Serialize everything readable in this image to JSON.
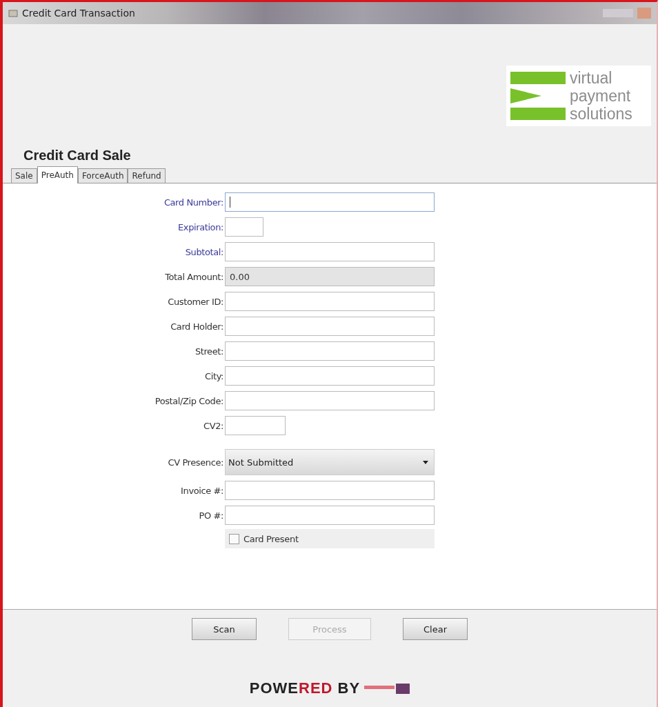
{
  "window": {
    "title": "Credit Card Transaction"
  },
  "logo": {
    "lines": [
      "virtual",
      "payment",
      "solutions"
    ]
  },
  "heading": "Credit Card Sale",
  "tabs": [
    {
      "label": "Sale",
      "selected": false
    },
    {
      "label": "PreAuth",
      "selected": true
    },
    {
      "label": "ForceAuth",
      "selected": false
    },
    {
      "label": "Refund",
      "selected": false
    }
  ],
  "fields": [
    {
      "kind": "text",
      "label": "Card Number:",
      "required": true,
      "focused": true
    },
    {
      "kind": "expiry",
      "label": "Expiration:",
      "required": true
    },
    {
      "kind": "text",
      "label": "Subtotal:",
      "required": true
    },
    {
      "kind": "text",
      "label": "Total Amount:",
      "required": false,
      "value": "0.00",
      "disabled": true
    },
    {
      "kind": "text",
      "label": "Customer ID:",
      "required": false
    },
    {
      "kind": "text",
      "label": "Card Holder:",
      "required": false
    },
    {
      "kind": "text",
      "label": "Street:",
      "required": false
    },
    {
      "kind": "text",
      "label": "City:",
      "required": false
    },
    {
      "kind": "text",
      "label": "Postal/Zip Code:",
      "required": false
    },
    {
      "kind": "code",
      "label": "CV2:",
      "required": false
    },
    {
      "kind": "select",
      "label": "CV Presence:",
      "required": false,
      "value": "Not Submitted"
    },
    {
      "kind": "text",
      "label": "Invoice #:",
      "required": false
    },
    {
      "kind": "text",
      "label": "PO #:",
      "required": false
    },
    {
      "kind": "checkbox",
      "label": "Card Present",
      "checked": false
    }
  ],
  "buttons": [
    {
      "label": "Scan",
      "disabled": false
    },
    {
      "label": "Process",
      "disabled": true
    },
    {
      "label": "Clear",
      "disabled": false
    }
  ],
  "powered_by": [
    {
      "text": "POWE",
      "accent": false
    },
    {
      "text": "RED",
      "accent": true
    },
    {
      "text": " BY",
      "accent": false
    }
  ]
}
